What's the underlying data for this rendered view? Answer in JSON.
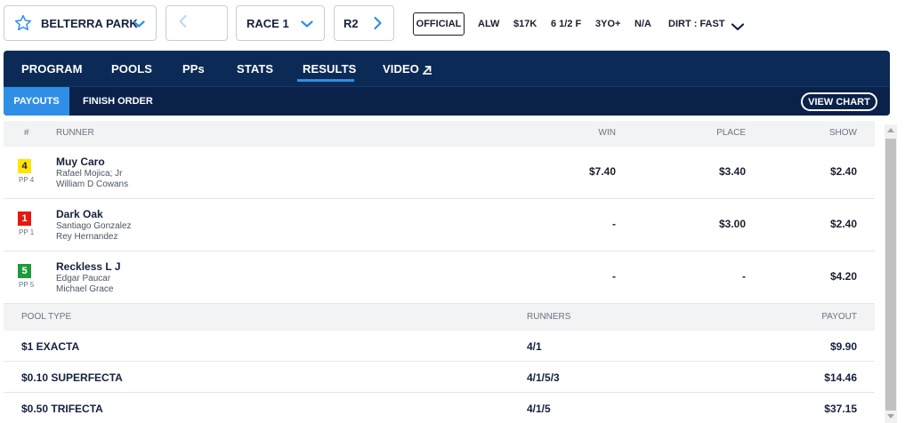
{
  "selectors": {
    "track": "BELTERRA PARK",
    "race": "RACE 1",
    "next_race": "R2"
  },
  "race_info": {
    "status": "OFFICIAL",
    "race_type": "ALW",
    "purse": "$17K",
    "distance": "6 1/2 F",
    "age": "3YO+",
    "sex": "N/A",
    "surface": "DIRT : FAST"
  },
  "nav": {
    "tabs": [
      "PROGRAM",
      "POOLS",
      "PPs",
      "STATS",
      "RESULTS",
      "VIDEO"
    ],
    "active_tab": "RESULTS",
    "sub_tabs": [
      "PAYOUTS",
      "FINISH ORDER"
    ],
    "active_sub_tab": "PAYOUTS",
    "view_chart": "VIEW CHART"
  },
  "results": {
    "headers": {
      "num": "#",
      "runner": "RUNNER",
      "win": "WIN",
      "place": "PLACE",
      "show": "SHOW"
    },
    "rows": [
      {
        "program": "4",
        "pp_label": "PP 4",
        "horse": "Muy Caro",
        "jockey": "Rafael Mojica; Jr",
        "trainer": "William D Cowans",
        "win": "$7.40",
        "place": "$3.40",
        "show": "$2.40",
        "badge_color": "#ffe600",
        "badge_text_color": "#1a1f2e"
      },
      {
        "program": "1",
        "pp_label": "PP 1",
        "horse": "Dark Oak",
        "jockey": "Santiago Gonzalez",
        "trainer": "Rey Hernandez",
        "win": "-",
        "place": "$3.00",
        "show": "$2.40",
        "badge_color": "#e8180f",
        "badge_text_color": "#ffffff"
      },
      {
        "program": "5",
        "pp_label": "PP 5",
        "horse": "Reckless L J",
        "jockey": "Edgar Paucar",
        "trainer": "Michael Grace",
        "win": "-",
        "place": "-",
        "show": "$4.20",
        "badge_color": "#1e9a3c",
        "badge_text_color": "#ffffff"
      }
    ]
  },
  "pools": {
    "headers": {
      "type": "POOL TYPE",
      "runners": "RUNNERS",
      "payout": "PAYOUT"
    },
    "rows": [
      {
        "type": "$1 EXACTA",
        "runners": "4/1",
        "payout": "$9.90"
      },
      {
        "type": "$0.10 SUPERFECTA",
        "runners": "4/1/5/3",
        "payout": "$14.46"
      },
      {
        "type": "$0.50 TRIFECTA",
        "runners": "4/1/5",
        "payout": "$37.15"
      }
    ]
  },
  "colors": {
    "nav_bg": "#0b2a55",
    "accent": "#2f8fe6"
  }
}
